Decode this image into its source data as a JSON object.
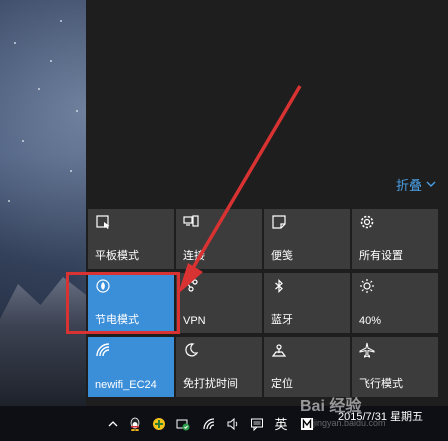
{
  "action_center": {
    "collapse_label": "折叠",
    "tiles": [
      {
        "label": "平板模式",
        "icon": "tablet-mode-icon"
      },
      {
        "label": "连接",
        "icon": "connect-icon"
      },
      {
        "label": "便笺",
        "icon": "note-icon"
      },
      {
        "label": "所有设置",
        "icon": "settings-gear-icon"
      },
      {
        "label": "节电模式",
        "icon": "battery-saver-icon",
        "active": true
      },
      {
        "label": "VPN",
        "icon": "vpn-icon"
      },
      {
        "label": "蓝牙",
        "icon": "bluetooth-icon"
      },
      {
        "label": "40%",
        "icon": "brightness-icon"
      },
      {
        "label": "newifi_EC24",
        "icon": "wifi-icon",
        "active": true
      },
      {
        "label": "免打扰时间",
        "icon": "quiet-hours-moon-icon"
      },
      {
        "label": "定位",
        "icon": "location-icon"
      },
      {
        "label": "飞行模式",
        "icon": "airplane-mode-icon"
      }
    ]
  },
  "taskbar": {
    "ime_label": "英",
    "clock_date": "2015/7/31 星期五"
  },
  "watermark": {
    "text": "Bai 经验",
    "sub": "jingyan.baidu.com"
  },
  "colors": {
    "accent": "#3b8ed8",
    "tile": "#3c3c3c",
    "panel": "#1e1e1e",
    "link": "#4a9fe6",
    "annotation": "#d83232"
  }
}
